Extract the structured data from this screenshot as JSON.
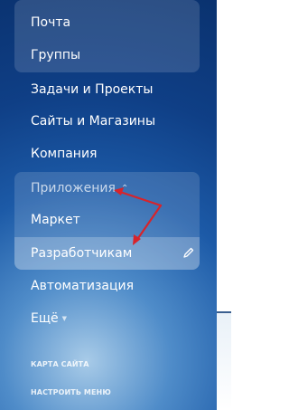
{
  "menu": {
    "top_items": [
      "Почта",
      "Группы"
    ],
    "items": [
      "Задачи и Проекты",
      "Сайты и Магазины",
      "Компания"
    ],
    "apps_label": "Приложения",
    "sub_items": [
      "Маркет",
      "Разработчикам"
    ],
    "automation": "Автоматизация",
    "more": "Ещё"
  },
  "footer": {
    "site_map": "КАРТА САЙТА",
    "customize_menu": "НАСТРОИТЬ МЕНЮ"
  },
  "colors": {
    "panel_top": "#0a326f",
    "panel_glow": "#a8cbe8",
    "arrow": "#d8232a"
  }
}
